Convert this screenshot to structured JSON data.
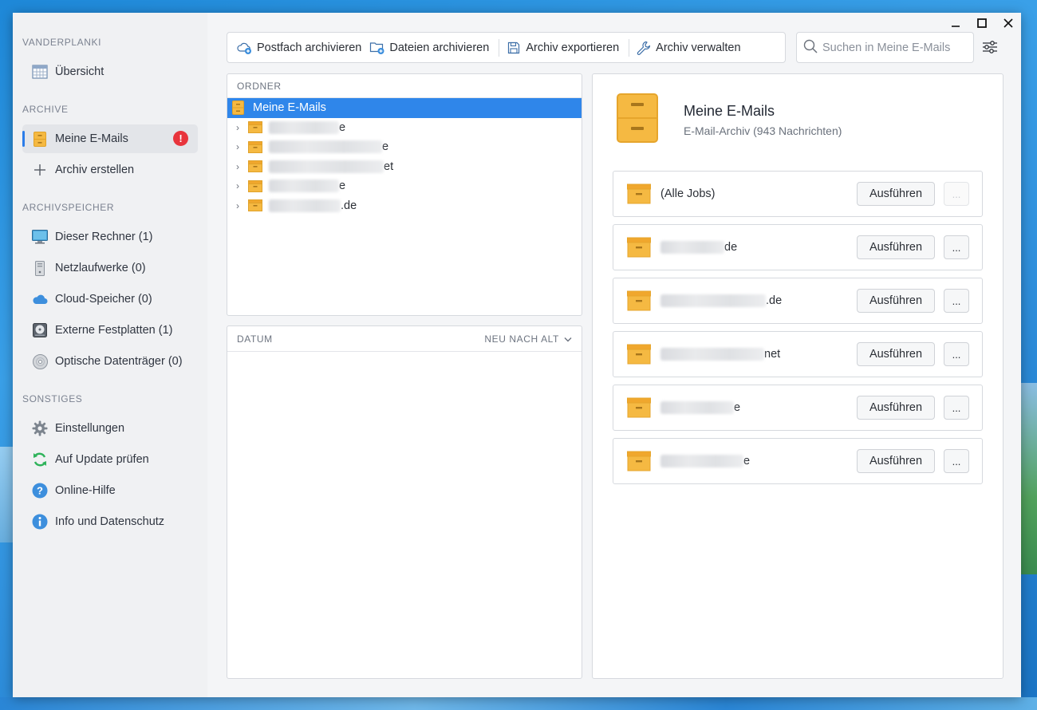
{
  "window": {
    "controls": [
      "minimize-icon",
      "maximize-icon",
      "close-icon"
    ]
  },
  "sidebar": {
    "sections": [
      {
        "title": "VANDERPLANKI",
        "items": [
          {
            "label": "Übersicht",
            "icon": "calendar-grid-icon"
          }
        ]
      },
      {
        "title": "ARCHIVE",
        "items": [
          {
            "label": "Meine E-Mails",
            "icon": "archive-cabinet-icon",
            "active": true,
            "alert": "!"
          },
          {
            "label": "Archiv erstellen",
            "icon": "plus-icon"
          }
        ]
      },
      {
        "title": "ARCHIVSPEICHER",
        "items": [
          {
            "label": "Dieser Rechner (1)",
            "icon": "monitor-icon"
          },
          {
            "label": "Netzlaufwerke (0)",
            "icon": "network-drive-icon"
          },
          {
            "label": "Cloud-Speicher (0)",
            "icon": "cloud-icon"
          },
          {
            "label": "Externe Festplatten (1)",
            "icon": "external-disk-icon"
          },
          {
            "label": "Optische Datenträger (0)",
            "icon": "optical-disc-icon"
          }
        ]
      },
      {
        "title": "SONSTIGES",
        "items": [
          {
            "label": "Einstellungen",
            "icon": "gear-icon"
          },
          {
            "label": "Auf Update prüfen",
            "icon": "refresh-icon"
          },
          {
            "label": "Online-Hilfe",
            "icon": "help-icon"
          },
          {
            "label": "Info und Datenschutz",
            "icon": "info-icon"
          }
        ]
      }
    ]
  },
  "toolbar": {
    "archive_mailbox": "Postfach archivieren",
    "archive_files": "Dateien archivieren",
    "export_archive": "Archiv exportieren",
    "manage_archive": "Archiv verwalten"
  },
  "search": {
    "placeholder": "Suchen in Meine E-Mails"
  },
  "folders": {
    "header": "ORDNER",
    "root": "Meine E-Mails",
    "children": [
      {
        "visible_suffix": "e"
      },
      {
        "visible_suffix": "e"
      },
      {
        "visible_suffix": "et"
      },
      {
        "visible_suffix": "e"
      },
      {
        "visible_suffix": ".de"
      }
    ]
  },
  "datum": {
    "header": "DATUM",
    "sort": "NEU NACH ALT"
  },
  "detail": {
    "title": "Meine E-Mails",
    "subtitle": "E-Mail-Archiv (943 Nachrichten)",
    "run_label": "Ausführen",
    "more_label": "...",
    "jobs": [
      {
        "name": "(Alle Jobs)",
        "more_disabled": true
      },
      {
        "visible_suffix": "de"
      },
      {
        "visible_suffix": ".de"
      },
      {
        "visible_suffix": "net"
      },
      {
        "visible_suffix": "e"
      },
      {
        "visible_suffix": "e"
      }
    ]
  },
  "colors": {
    "accent": "#2f86ea",
    "alert": "#e8343c",
    "archive": "#f5b942"
  }
}
